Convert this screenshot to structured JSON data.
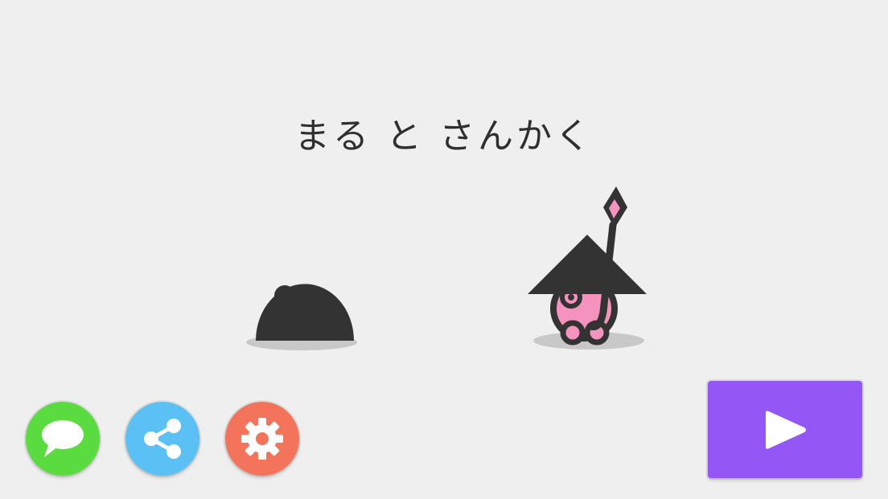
{
  "title": "まる と さんかく",
  "characters": {
    "maru": {
      "name": "まる"
    },
    "sankaku": {
      "name": "さんかく"
    }
  },
  "buttons": {
    "chat": {
      "icon": "speech-bubble-icon",
      "color": "#5adb3f"
    },
    "share": {
      "icon": "share-icon",
      "color": "#5bc1f4"
    },
    "settings": {
      "icon": "gear-icon",
      "color": "#f3745a"
    },
    "play": {
      "icon": "play-icon",
      "color": "#9457f5"
    }
  },
  "colors": {
    "background": "#efefef",
    "ink": "#333333",
    "pink": "#f592bd",
    "shadow": "#c8c8c8"
  }
}
